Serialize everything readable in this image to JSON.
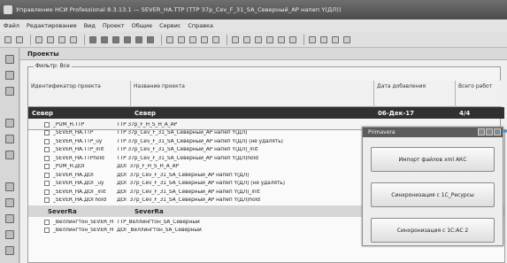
{
  "window": {
    "title": "Управление НСИ Professional 8.3.13.1 — SEVER_HA.TTP (ТТР 37р_Сev_F_31_SA_Северный_АР напеп Y(ДЛ))"
  },
  "menu": [
    "Файл",
    "Редактирование",
    "Вид",
    "Проект",
    "Общие",
    "Сервис",
    "Справка"
  ],
  "tab": {
    "title": "Проекты"
  },
  "filter": {
    "legend": "Фильтр: Все"
  },
  "table": {
    "columns": [
      "Идентификатор проекта",
      "Название проекта",
      "Дата добавления",
      "Всего работ"
    ],
    "groups": [
      {
        "id": "Север",
        "name": "Север",
        "date": "06-Дек-17",
        "count": "4/4",
        "rows": [
          {
            "id": "_PUM_H.TTP",
            "name": "ТТР 37р_F_H_S_H_A_AP"
          },
          {
            "id": "_SEVER_HA.TTP",
            "name": "ТТР 37р_Сev_F_31_SA_Северный_АР напеп Y(ДЛ)"
          },
          {
            "id": "_SEVER_HA.TTP_uy",
            "name": "ТТР 37р_Сev_F_31_SA_Северный_АР напеп Y(ДЛ) (не удалять)"
          },
          {
            "id": "_SEVER_HA.TTP_init",
            "name": "ТТР 37р_Сev_F_31_SA_Северный_АР напеп Y(ДЛ)_init"
          },
          {
            "id": "_SEVER_HA.TTPhold",
            "name": "ТТР 37р_Сev_F_31_SA_Северный_АР напеп Y(ДЛ)hold"
          },
          {
            "id": "_PUM_H.ДОГ",
            "name": "ДОГ 37р_F_H_S_H_A_AP"
          },
          {
            "id": "_SEVER_HA.ДОГ",
            "name": "ДОГ 37р_Сev_F_31_SA_Северный_АР напеп Y(ДЛ)"
          },
          {
            "id": "_SEVER_HA.ДОГ_uy",
            "name": "ДОГ 37р_Сev_F_31_SA_Северный_АР напеп Y(ДЛ) (не удалять)"
          },
          {
            "id": "_SEVER_HA.ДОГ_init",
            "name": "ДОГ 37р_Сev_F_31_SA_Северный_АР напеп Y(ДЛ)_init"
          },
          {
            "id": "_SEVER_HA.ДОГhold",
            "name": "ДОГ 37р_Сev_F_31_SA_Северный_АР напеп Y(ДЛ)hold"
          }
        ]
      },
      {
        "id": "SeverRa",
        "name": "SeverRa",
        "rows": [
          {
            "id": "_Веллингтон_SEVER_HA.TTP",
            "name": "ТТР_Веллингтон_SA_Северный"
          },
          {
            "id": "_Веллингтон_SEVER_HA.ДОГ",
            "name": "ДОГ_Веллингтон_SA_Северный"
          }
        ]
      }
    ]
  },
  "dialog": {
    "title": "Primavera",
    "buttons": [
      "Импорт файлов xml АКС",
      "Синхронизация с 1С_Ресурсы",
      "Синхронизация с 1С:АС 2"
    ]
  }
}
